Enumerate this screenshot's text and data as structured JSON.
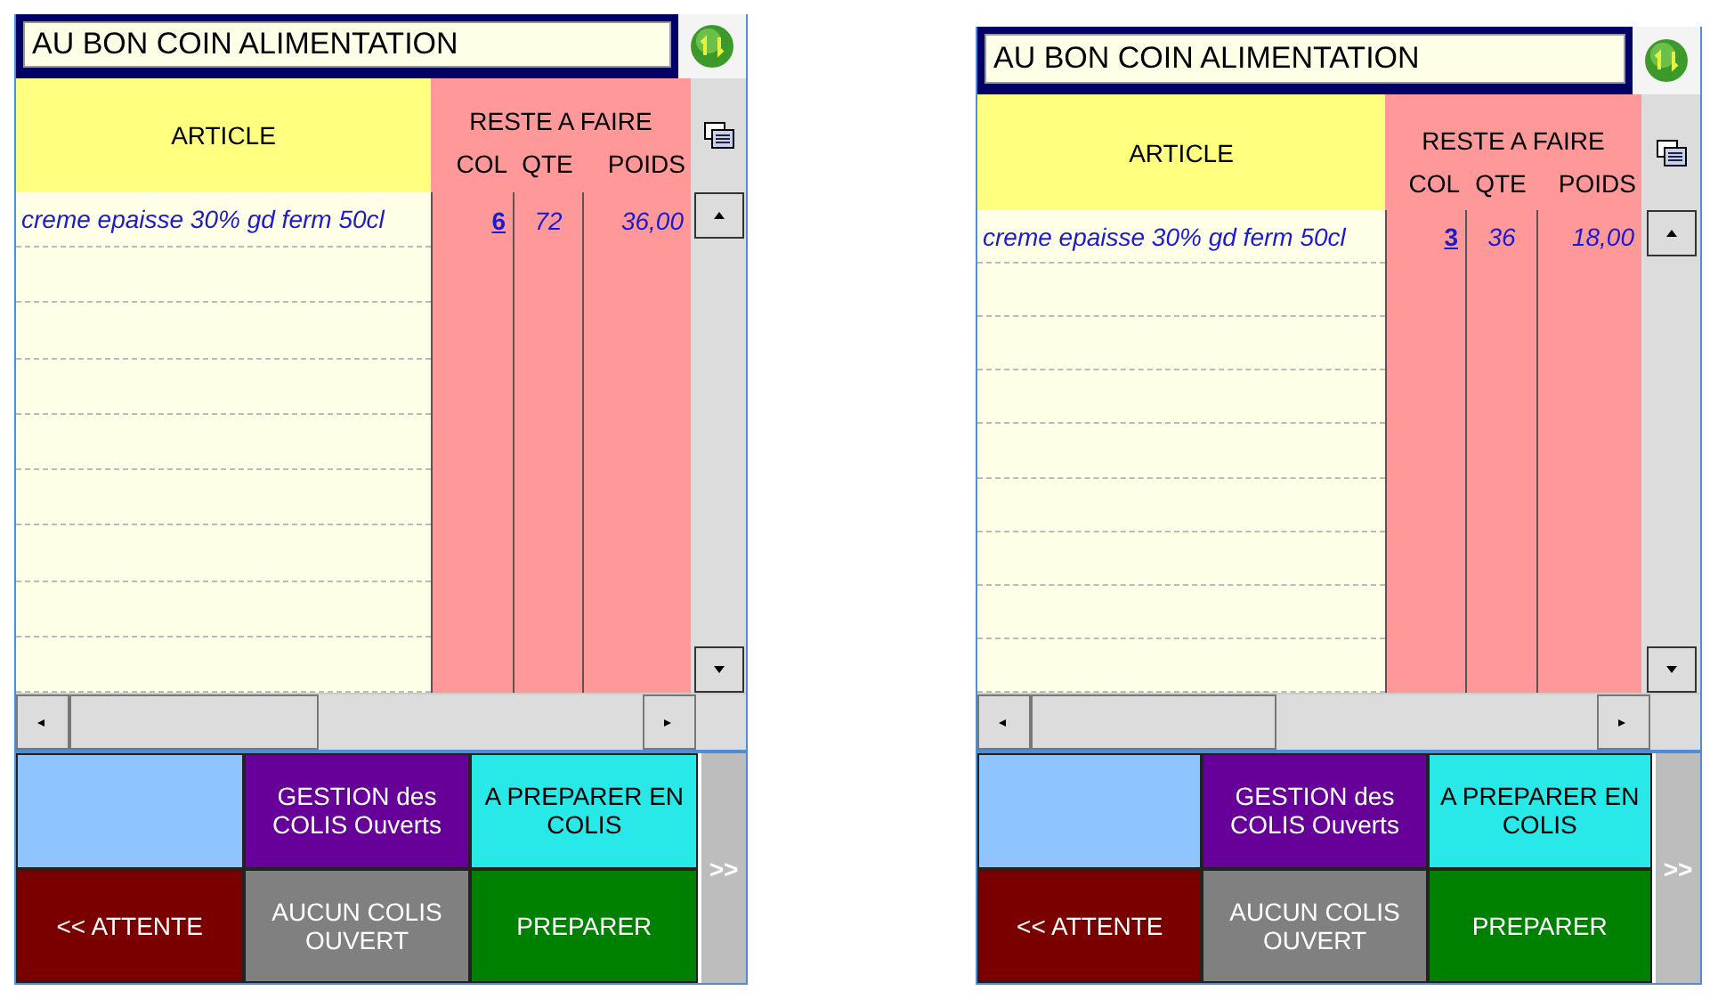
{
  "panels": [
    {
      "title": "AU BON COIN ALIMENTATION",
      "table": {
        "columns": {
          "article": "ARTICLE",
          "group": "RESTE A FAIRE",
          "col": "COL",
          "qte": "QTE",
          "poids": "POIDS"
        },
        "rows": [
          {
            "article": "creme epaisse 30% gd ferm 50cl",
            "col": "6",
            "qte": "72",
            "poids": "36,00"
          }
        ]
      },
      "buttons": [
        {
          "color": "#90c4ff"
        },
        {
          "label": "GESTION des COLIS Ouverts",
          "color": "#660099"
        },
        {
          "label": "A PREPARER EN COLIS",
          "color": "#28e8e8"
        },
        {
          "label": "<< ATTENTE",
          "color": "#7a0000"
        },
        {
          "label": "AUCUN COLIS OUVERT",
          "color": "#808080"
        },
        {
          "label": "PREPARER",
          "color": "#008000"
        }
      ],
      "next_button": ">>"
    },
    {
      "title": "AU BON COIN ALIMENTATION",
      "table": {
        "columns": {
          "article": "ARTICLE",
          "group": "RESTE A FAIRE",
          "col": "COL",
          "qte": "QTE",
          "poids": "POIDS"
        },
        "rows": [
          {
            "article": "creme epaisse 30% gd ferm 50cl",
            "col": "3",
            "qte": "36",
            "poids": "18,00"
          }
        ]
      },
      "buttons": [
        {
          "color": "#90c4ff"
        },
        {
          "label": "GESTION des COLIS Ouverts",
          "color": "#660099"
        },
        {
          "label": "A PREPARER EN COLIS",
          "color": "#28e8e8"
        },
        {
          "label": "<< ATTENTE",
          "color": "#7a0000"
        },
        {
          "label": "AUCUN COLIS OUVERT",
          "color": "#808080"
        },
        {
          "label": "PREPARER",
          "color": "#008000"
        }
      ],
      "next_button": ">>"
    }
  ]
}
